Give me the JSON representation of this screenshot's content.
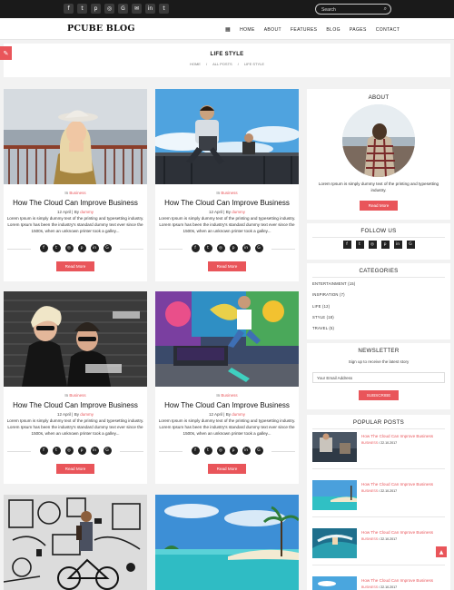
{
  "social_top": [
    {
      "icon": "facebook-icon",
      "glyph": "f"
    },
    {
      "icon": "twitter-icon",
      "glyph": "t"
    },
    {
      "icon": "pinterest-icon",
      "glyph": "p"
    },
    {
      "icon": "instagram-icon",
      "glyph": "◎"
    },
    {
      "icon": "google-plus-icon",
      "glyph": "G"
    },
    {
      "icon": "email-icon",
      "glyph": "✉"
    },
    {
      "icon": "linkedin-icon",
      "glyph": "in"
    },
    {
      "icon": "tumblr-icon",
      "glyph": "t"
    }
  ],
  "search": {
    "placeholder": "Search",
    "icon": "search-icon"
  },
  "header": {
    "logo": "PCUBE BLOG",
    "nav": [
      "HOME",
      "ABOUT",
      "FEATURES",
      "BLOG",
      "PAGES",
      "CONTACT"
    ]
  },
  "page": {
    "title": "LIFE STYLE",
    "breadcrumbs": [
      "HOME",
      "/",
      "ALL POSTS",
      "/",
      "LIFE STYLE"
    ]
  },
  "posts": [
    {
      "category_prefix": "In",
      "category": "Business",
      "title": "How The Cloud Can Improve Business",
      "date": "12 April",
      "by": "| By",
      "author": "dummy",
      "excerpt": "Lorem Ipsum is simply dummy text of the printing and typesetting industry. Lorem Ipsum has been the industry's standard dummy text ever since the 1500s, when an unknown printer took a galley...",
      "button": "Read More"
    },
    {
      "category_prefix": "In",
      "category": "Business",
      "title": "How The Cloud Can Improve Business",
      "date": "12 April",
      "by": "| By",
      "author": "dummy",
      "excerpt": "Lorem Ipsum is simply dummy text of the printing and typesetting industry. Lorem Ipsum has been the industry's standard dummy text ever since the 1500s, when an unknown printer took a galley...",
      "button": "Read More"
    },
    {
      "category_prefix": "In",
      "category": "Business",
      "title": "How The Cloud Can Improve Business",
      "date": "12 April",
      "by": "| By",
      "author": "dummy",
      "excerpt": "Lorem Ipsum is simply dummy text of the printing and typesetting industry. Lorem Ipsum has been the industry's standard dummy text ever since the 1500s, when an unknown printer took a galley...",
      "button": "Read More"
    },
    {
      "category_prefix": "In",
      "category": "Business",
      "title": "How The Cloud Can Improve Business",
      "date": "12 April",
      "by": "| By",
      "author": "dummy",
      "excerpt": "Lorem Ipsum is simply dummy text of the printing and typesetting industry. Lorem Ipsum has been the industry's standard dummy text ever since the 1500s, when an unknown printer took a galley...",
      "button": "Read More"
    }
  ],
  "share_icons": [
    {
      "icon": "facebook-icon",
      "glyph": "f"
    },
    {
      "icon": "twitter-icon",
      "glyph": "t"
    },
    {
      "icon": "instagram-icon",
      "glyph": "◎"
    },
    {
      "icon": "pinterest-icon",
      "glyph": "p"
    },
    {
      "icon": "linkedin-icon",
      "glyph": "in"
    },
    {
      "icon": "google-plus-icon",
      "glyph": "G"
    }
  ],
  "sidebar": {
    "about": {
      "title": "ABOUT",
      "text": "Lorem Ipsum is simply dummy text of the printing and typesetting industry.",
      "button": "Read More"
    },
    "follow": {
      "title": "FOLLOW US"
    },
    "categories": {
      "title": "CATEGORIES",
      "items": [
        "ENTERTAINMENT (15)",
        "INSPIRATION (7)",
        "LIFE (12)",
        "STYLE (18)",
        "TRAVEL (5)"
      ]
    },
    "newsletter": {
      "title": "NEWSLETTER",
      "subtitle": "Sign up to receive the latest story",
      "placeholder": "Your Email Address",
      "button": "SUBSCRIBE"
    },
    "popular": {
      "title": "POPULAR POSTS",
      "items": [
        {
          "title": "How The Cloud Can Improve Business",
          "category": "BUSINESS",
          "sep": "/",
          "date": "22.10.2017"
        },
        {
          "title": "How The Cloud Can Improve Business",
          "category": "BUSINESS",
          "sep": "/",
          "date": "22.10.2017"
        },
        {
          "title": "How The Cloud Can Improve Business",
          "category": "BUSINESS",
          "sep": "/",
          "date": "22.10.2017"
        },
        {
          "title": "How The Cloud Can Improve Business",
          "category": "BUSINESS",
          "sep": "/",
          "date": "22.10.2017"
        }
      ]
    }
  },
  "colors": {
    "accent": "#e9555a",
    "topbar": "#1a1a1a"
  }
}
